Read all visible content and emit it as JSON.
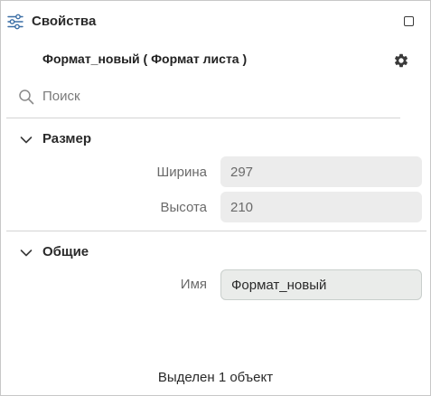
{
  "header": {
    "title": "Свойства",
    "icon": "sliders-icon",
    "maximize_icon": "maximize-icon"
  },
  "object": {
    "title": "Формат_новый ( Формат листа )",
    "settings_icon": "gear-icon"
  },
  "search": {
    "placeholder": "Поиск",
    "value": "",
    "icon": "search-icon"
  },
  "sections": [
    {
      "label": "Размер",
      "expanded": true,
      "properties": [
        {
          "label": "Ширина",
          "value": "297"
        },
        {
          "label": "Высота",
          "value": "210"
        }
      ]
    },
    {
      "label": "Общие",
      "expanded": true,
      "properties": [
        {
          "label": "Имя",
          "value": "Формат_новый"
        }
      ]
    }
  ],
  "footer": {
    "status": "Выделен 1 объект"
  },
  "colors": {
    "accent": "#3a6ea5",
    "field_bg": "#ececec",
    "text_muted": "#6a6a6a"
  }
}
